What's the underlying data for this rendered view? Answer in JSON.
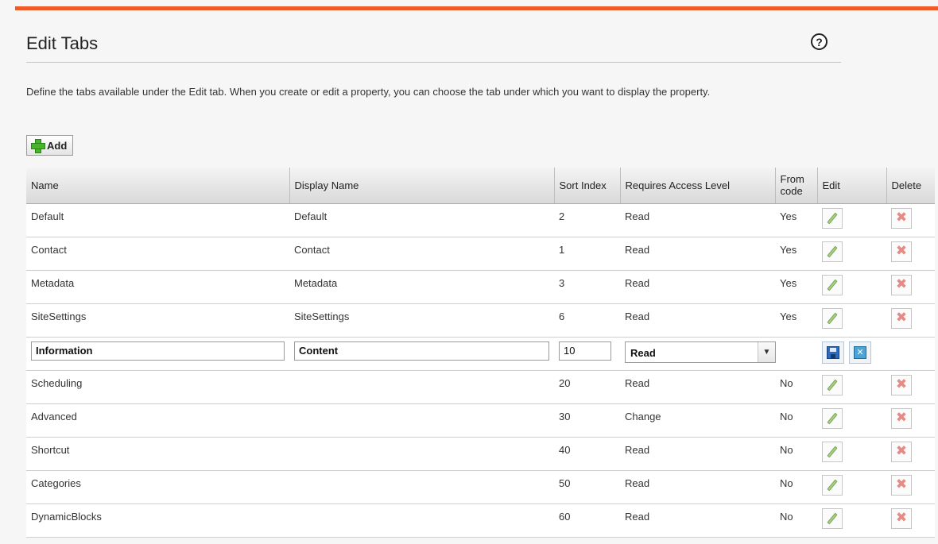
{
  "page": {
    "title": "Edit Tabs",
    "help_label": "?",
    "description": "Define the tabs available under the Edit tab. When you create or edit a property, you can choose the tab under which you want to display the property.",
    "add_label": "Add"
  },
  "table": {
    "headers": {
      "name": "Name",
      "display_name": "Display Name",
      "sort_index": "Sort Index",
      "access": "Requires Access Level",
      "from_code": "From code",
      "edit": "Edit",
      "delete": "Delete"
    },
    "rows": [
      {
        "name": "Default",
        "display_name": "Default",
        "sort": "2",
        "access": "Read",
        "from_code": "Yes"
      },
      {
        "name": "Contact",
        "display_name": "Contact",
        "sort": "1",
        "access": "Read",
        "from_code": "Yes"
      },
      {
        "name": "Metadata",
        "display_name": "Metadata",
        "sort": "3",
        "access": "Read",
        "from_code": "Yes"
      },
      {
        "name": "SiteSettings",
        "display_name": "SiteSettings",
        "sort": "6",
        "access": "Read",
        "from_code": "Yes"
      },
      {
        "edit": true,
        "name": "Information",
        "display_name": "Content",
        "sort": "10",
        "access": "Read"
      },
      {
        "name": "Scheduling",
        "display_name": "",
        "sort": "20",
        "access": "Read",
        "from_code": "No"
      },
      {
        "name": "Advanced",
        "display_name": "",
        "sort": "30",
        "access": "Change",
        "from_code": "No"
      },
      {
        "name": "Shortcut",
        "display_name": "",
        "sort": "40",
        "access": "Read",
        "from_code": "No"
      },
      {
        "name": "Categories",
        "display_name": "",
        "sort": "50",
        "access": "Read",
        "from_code": "No"
      },
      {
        "name": "DynamicBlocks",
        "display_name": "",
        "sort": "60",
        "access": "Read",
        "from_code": "No"
      }
    ]
  },
  "icons": {
    "add": "plus-icon",
    "help": "help-icon",
    "edit": "pencil-icon",
    "delete": "delete-icon",
    "save": "save-icon",
    "cancel": "cancel-icon",
    "dropdown": "chevron-down-icon"
  },
  "colors": {
    "accent_bar": "#f05a28",
    "add_plus": "#46b52c",
    "delete_x": "#e58a84",
    "save_blue": "#2a6cc2"
  }
}
